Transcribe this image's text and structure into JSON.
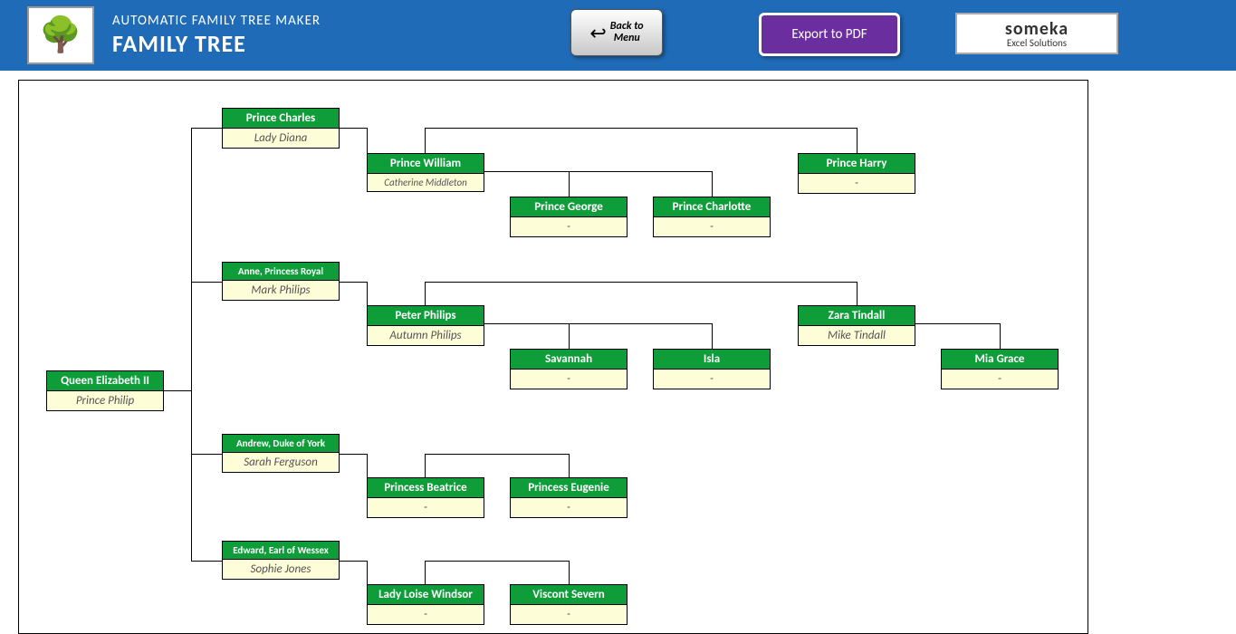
{
  "header": {
    "subtitle": "AUTOMATIC FAMILY TREE MAKER",
    "title": "FAMILY TREE",
    "back_line1": "Back to",
    "back_line2": "Menu",
    "export": "Export to PDF",
    "brand_line1": "someka",
    "brand_line2": "Excel Solutions"
  },
  "tree": {
    "root_name": "Queen Elizabeth II",
    "root_spouse": "Prince Philip",
    "children": [
      {
        "name": "Prince Charles",
        "spouse": "Lady Diana",
        "children": [
          {
            "name": "Prince William",
            "spouse": "Catherine Middleton",
            "children": [
              {
                "name": "Prince George",
                "spouse": "-"
              },
              {
                "name": "Prince Charlotte",
                "spouse": "-"
              }
            ]
          },
          {
            "name": "Prince Harry",
            "spouse": "-"
          }
        ]
      },
      {
        "name": "Anne, Princess Royal",
        "spouse": "Mark Philips",
        "children": [
          {
            "name": "Peter Philips",
            "spouse": "Autumn Philips",
            "children": [
              {
                "name": "Savannah",
                "spouse": "-"
              },
              {
                "name": "Isla",
                "spouse": "-"
              }
            ]
          },
          {
            "name": "Zara Tindall",
            "spouse": "Mike Tindall",
            "children": [
              {
                "name": "Mia Grace",
                "spouse": "-"
              }
            ]
          }
        ]
      },
      {
        "name": "Andrew, Duke of York",
        "spouse": "Sarah Ferguson",
        "children": [
          {
            "name": "Princess Beatrice",
            "spouse": "-"
          },
          {
            "name": "Princess Eugenie",
            "spouse": "-"
          }
        ]
      },
      {
        "name": "Edward, Earl of Wessex",
        "spouse": "Sophie Jones",
        "children": [
          {
            "name": "Lady Loise Windsor",
            "spouse": "-"
          },
          {
            "name": "Viscont Severn",
            "spouse": "-"
          }
        ]
      }
    ]
  }
}
